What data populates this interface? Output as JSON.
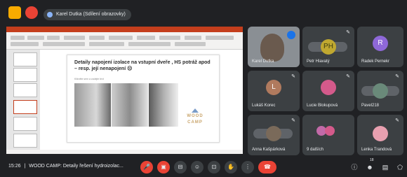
{
  "top": {
    "presenter_chip": "Karel Dutka (Sdílení obrazovky)"
  },
  "slide": {
    "title": "Detaily napojení izolace na vstupní dveře , HS potráž apod – resp. její nenapojení ☹",
    "bullet": "Klikněte sem a zadejte text",
    "logo_line1": "WOOD",
    "logo_line2": "CAMP"
  },
  "participants": [
    {
      "name": "Karel Dutka",
      "initials": "",
      "color": "#8ab4f8"
    },
    {
      "name": "Petr Hlavatý",
      "initials": "PH",
      "color": "#c0a830"
    },
    {
      "name": "Radek Pernekr",
      "initials": "R",
      "color": "#8e68d8"
    },
    {
      "name": "Lukáš Korec",
      "initials": "L",
      "color": "#b07a5e"
    },
    {
      "name": "Lucie Blokupová",
      "initials": "",
      "color": "#d45a8b"
    },
    {
      "name": "Pavel218",
      "initials": "",
      "color": "#6a8a7a"
    },
    {
      "name": "Anna Kašpárková",
      "initials": "",
      "color": "#7a6a5a"
    },
    {
      "name": "9 dalších",
      "initials": "",
      "color": "#c26aa8"
    },
    {
      "name": "Lenka Trandová",
      "initials": "",
      "color": "#e8a0b0"
    }
  ],
  "bottom": {
    "time": "15:26",
    "separator": "|",
    "meeting_title": "WOOD CAMP: Detaily řešení hydroizolac...",
    "participant_count": "18"
  },
  "colors": {
    "background": "#202124",
    "tile": "#3c4043",
    "danger": "#ea4335",
    "ppt_accent": "#c43e1c"
  }
}
